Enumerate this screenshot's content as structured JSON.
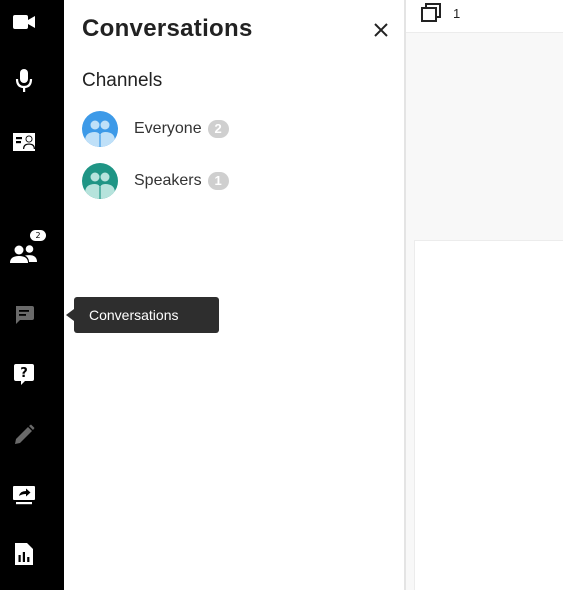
{
  "toolbar": {
    "tools": [
      {
        "name": "camera",
        "icon": "video-camera-icon"
      },
      {
        "name": "microphone",
        "icon": "microphone-icon"
      },
      {
        "name": "contact-card",
        "icon": "contact-card-icon"
      },
      {
        "name": "participants",
        "icon": "participants-icon",
        "badge": "2"
      },
      {
        "name": "conversations",
        "icon": "chat-icon"
      },
      {
        "name": "questions",
        "icon": "question-icon"
      },
      {
        "name": "annotate",
        "icon": "pencil-icon"
      },
      {
        "name": "share-screen",
        "icon": "screen-share-icon"
      },
      {
        "name": "polls",
        "icon": "poll-chart-icon"
      }
    ]
  },
  "tooltip": {
    "label": "Conversations"
  },
  "panel": {
    "title": "Conversations",
    "section_title": "Channels",
    "channels": [
      {
        "name": "Everyone",
        "count": "2",
        "color": "#3d9ae8"
      },
      {
        "name": "Speakers",
        "count": "1",
        "color": "#1f9585"
      }
    ]
  },
  "content": {
    "page_count": "1"
  },
  "colors": {
    "toolbar_bg": "#000000",
    "tooltip_bg": "#2e2e2e",
    "badge_bg": "#cfcfcf"
  }
}
